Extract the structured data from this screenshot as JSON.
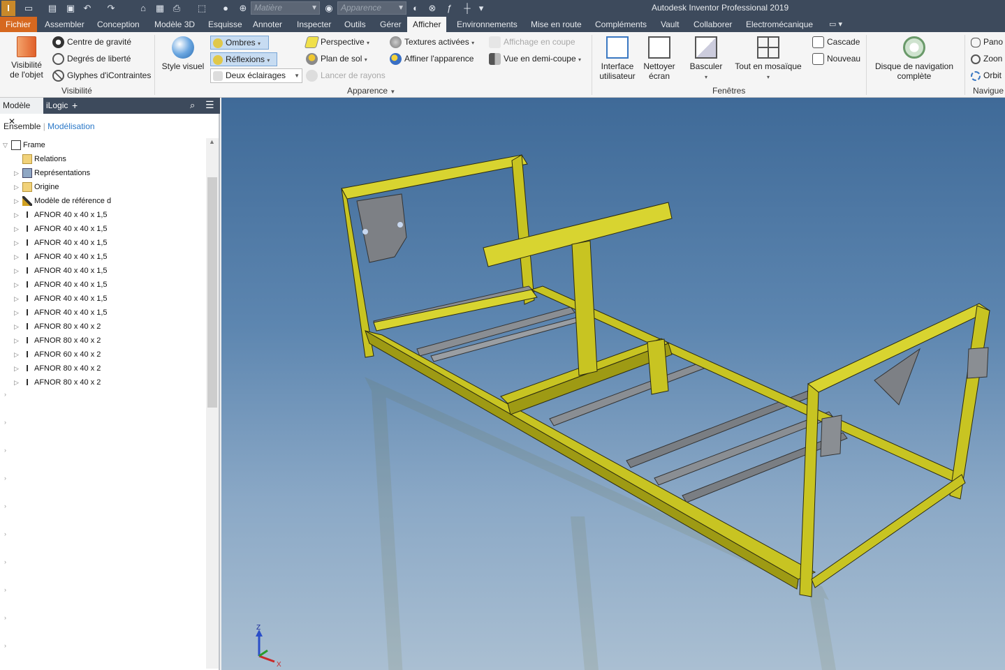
{
  "app": {
    "title": "Autodesk Inventor Professional 2019",
    "logo": "I"
  },
  "quick_access": {
    "material_placeholder": "Matière",
    "appearance_placeholder": "Apparence"
  },
  "tabs": [
    {
      "label": "Fichier"
    },
    {
      "label": "Assembler"
    },
    {
      "label": "Conception"
    },
    {
      "label": "Modèle 3D"
    },
    {
      "label": "Esquisse"
    },
    {
      "label": "Annoter"
    },
    {
      "label": "Inspecter"
    },
    {
      "label": "Outils"
    },
    {
      "label": "Gérer"
    },
    {
      "label": "Afficher"
    },
    {
      "label": "Environnements"
    },
    {
      "label": "Mise en route"
    },
    {
      "label": "Compléments"
    },
    {
      "label": "Vault"
    },
    {
      "label": "Collaborer"
    },
    {
      "label": "Electromécanique"
    }
  ],
  "ribbon": {
    "visibility": {
      "panel": "Visibilité",
      "object_visibility": "Visibilité de l'objet",
      "center_of_gravity": "Centre de gravité",
      "degrees_of_freedom": "Degrés de liberté",
      "iconstraint_glyphs": "Glyphes d'iContraintes"
    },
    "appearance": {
      "panel": "Apparence",
      "visual_style": "Style visuel",
      "shadows": "Ombres",
      "reflections": "Réflexions",
      "lighting": "Deux éclairages",
      "perspective": "Perspective",
      "ground_plane": "Plan de sol",
      "ray_tracing": "Lancer de rayons",
      "textures": "Textures activées",
      "refine_appearance": "Affiner l'apparence",
      "section_view": "Affichage en coupe",
      "half_section": "Vue en demi-coupe"
    },
    "windows": {
      "panel": "Fenêtres",
      "user_interface": "Interface utilisateur",
      "clean_screen": "Nettoyer écran",
      "switch": "Basculer",
      "tile_all": "Tout en mosaïque",
      "cascade": "Cascade",
      "new": "Nouveau"
    },
    "navigate": {
      "panel": "Navigue",
      "full_nav_wheel": "Disque de navigation complète",
      "pan": "Pano",
      "zoom": "Zoon",
      "orbit": "Orbit"
    }
  },
  "browser": {
    "tab_model": "Modèle",
    "tab_ilogic": "iLogic",
    "mode_assembly": "Ensemble",
    "mode_modeling": "Modélisation",
    "tree": [
      {
        "label": "Frame",
        "icon": "assembly-icon",
        "level": 0,
        "expanded": true
      },
      {
        "label": "Relations",
        "icon": "folder-icon",
        "level": 1
      },
      {
        "label": "Représentations",
        "icon": "representations-icon",
        "level": 1
      },
      {
        "label": "Origine",
        "icon": "folder-icon",
        "level": 1
      },
      {
        "label": "Modèle de référence d",
        "icon": "skeleton-icon",
        "level": 1
      },
      {
        "label": "AFNOR 40 x 40 x 1,5",
        "icon": "ibeam-icon",
        "level": 1
      },
      {
        "label": "AFNOR 40 x 40 x 1,5",
        "icon": "ibeam-icon",
        "level": 1
      },
      {
        "label": "AFNOR 40 x 40 x 1,5",
        "icon": "ibeam-icon",
        "level": 1
      },
      {
        "label": "AFNOR 40 x 40 x 1,5",
        "icon": "ibeam-icon",
        "level": 1
      },
      {
        "label": "AFNOR 40 x 40 x 1,5",
        "icon": "ibeam-icon",
        "level": 1
      },
      {
        "label": "AFNOR 40 x 40 x 1,5",
        "icon": "ibeam-icon",
        "level": 1
      },
      {
        "label": "AFNOR 40 x 40 x 1,5",
        "icon": "ibeam-icon",
        "level": 1
      },
      {
        "label": "AFNOR 40 x 40 x 1,5",
        "icon": "ibeam-icon",
        "level": 1
      },
      {
        "label": "AFNOR 80 x 40 x 2",
        "icon": "ibeam-icon",
        "level": 1
      },
      {
        "label": "AFNOR 80 x 40 x 2",
        "icon": "ibeam-icon",
        "level": 1
      },
      {
        "label": "AFNOR 60 x 40 x 2",
        "icon": "ibeam-icon",
        "level": 1
      },
      {
        "label": "AFNOR 80 x 40 x 2",
        "icon": "ibeam-icon",
        "level": 1
      },
      {
        "label": "AFNOR 80 x 40 x 2",
        "icon": "ibeam-icon",
        "level": 1
      }
    ]
  },
  "viewport": {
    "triad": {
      "x": "X",
      "z": "Z"
    },
    "colors": {
      "frame": "#c8c422",
      "frame_dark": "#8f8c12",
      "steel": "#8a8e93",
      "sky": "#3f6a98"
    }
  }
}
